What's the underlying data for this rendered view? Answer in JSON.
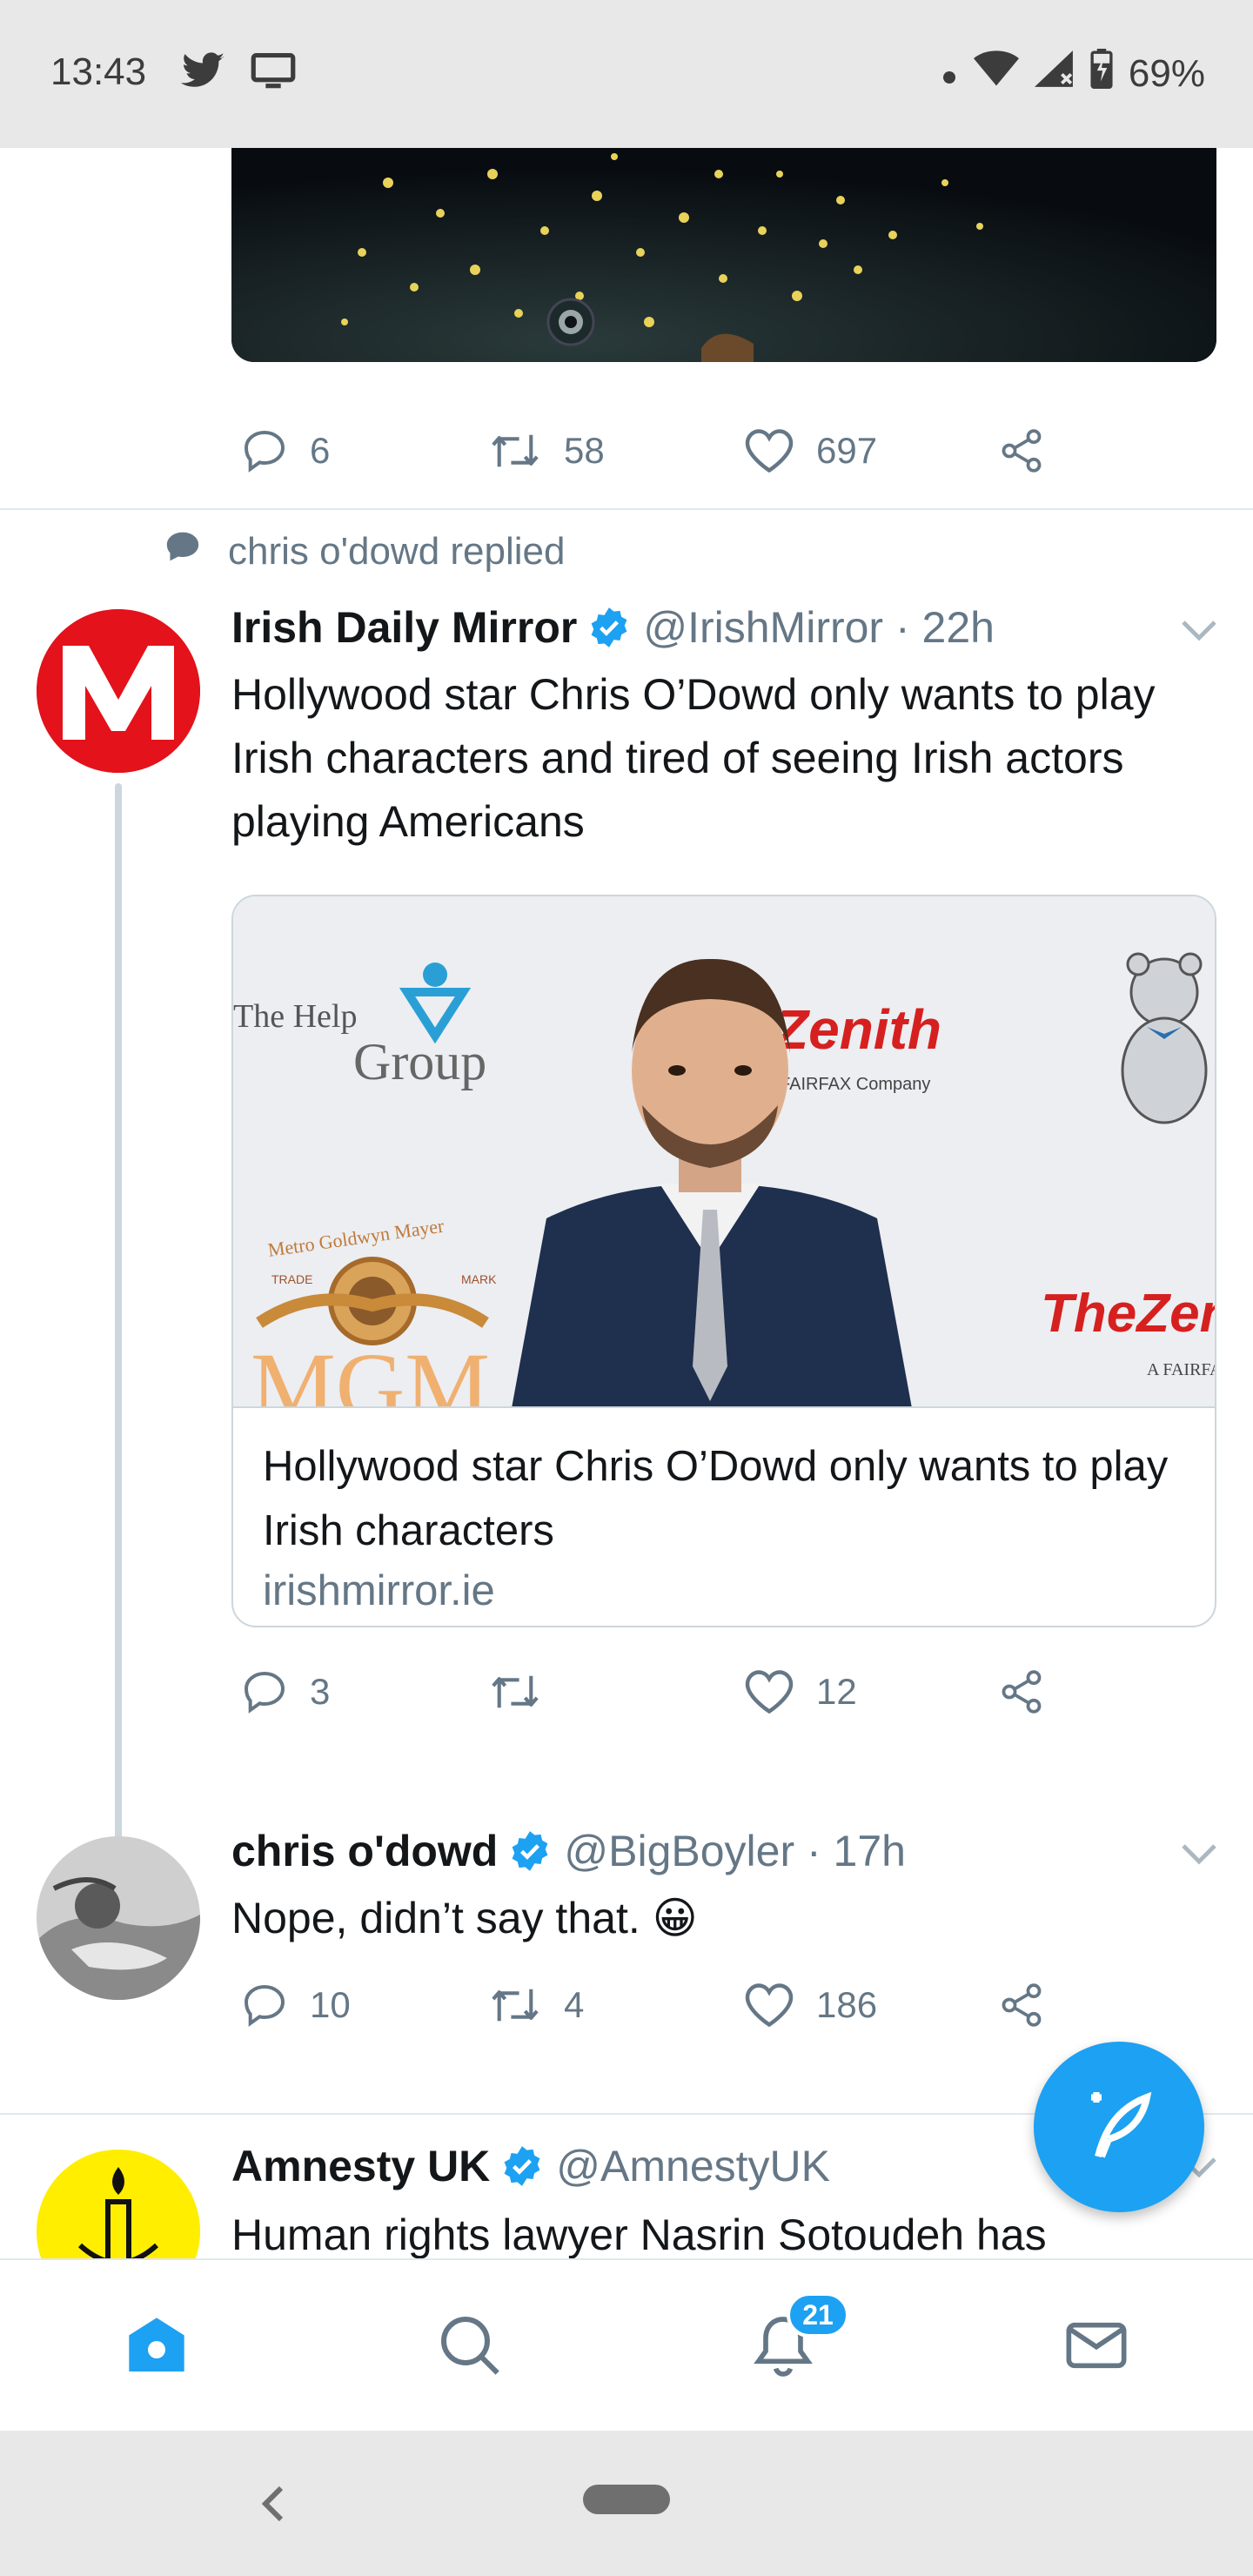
{
  "status_bar": {
    "time": "13:43",
    "battery": "69%",
    "left_icons": [
      "twitter-bird-icon",
      "monitor-icon"
    ],
    "right_icons": [
      "dot-icon",
      "wifi-icon",
      "signal-icon",
      "battery-charging-icon"
    ]
  },
  "top_tweet_actions": {
    "replies": "6",
    "retweets": "58",
    "likes": "697"
  },
  "reply_context": {
    "label": "chris o'dowd replied"
  },
  "tweets": [
    {
      "name": "Irish Daily Mirror",
      "verified": true,
      "handle": "@IrishMirror · 22h",
      "text": "Hollywood star Chris O’Dowd only wants to play Irish characters and tired of seeing Irish actors playing Americans",
      "card": {
        "title": "Hollywood star Chris O’Dowd only wants to play Irish characters",
        "domain": "irishmirror.ie",
        "image_texts": [
          "The Help",
          "Group",
          "Zenith",
          "FAIRFAX Company",
          "Metro Goldwyn Mayer",
          "TRADE",
          "MARK",
          "MGM",
          "TheZen",
          "A FAIRFAX"
        ]
      },
      "actions": {
        "replies": "3",
        "retweets": "",
        "likes": "12"
      }
    },
    {
      "name": "chris o'dowd",
      "verified": true,
      "handle": "@BigBoyler · 17h",
      "text": "Nope, didn’t say that. 😀",
      "actions": {
        "replies": "10",
        "retweets": "4",
        "likes": "186"
      }
    },
    {
      "name": "Amnesty UK",
      "verified": true,
      "handle": "@AmnestyUK",
      "text": "Human rights lawyer Nasrin Sotoudeh has"
    }
  ],
  "bottom_nav": {
    "items": [
      "home-icon",
      "search-icon",
      "notifications-icon",
      "messages-icon"
    ],
    "notifications_badge": "21"
  },
  "colors": {
    "accent": "#1da1f2",
    "muted": "#657786",
    "text": "#14171a",
    "divider": "#e1e8ed",
    "mirror_red": "#e3121b",
    "amnesty_yellow": "#ffee00"
  }
}
